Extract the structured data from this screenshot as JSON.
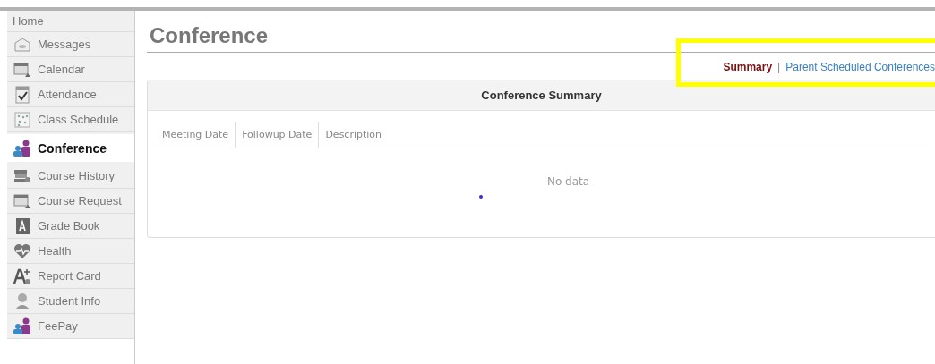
{
  "sidebar": {
    "home": "Home",
    "items": [
      {
        "label": "Messages",
        "selected": false
      },
      {
        "label": "Calendar",
        "selected": false
      },
      {
        "label": "Attendance",
        "selected": false
      },
      {
        "label": "Class Schedule",
        "selected": false
      },
      {
        "label": "Conference",
        "selected": true
      },
      {
        "label": "Course History",
        "selected": false
      },
      {
        "label": "Course Request",
        "selected": false
      },
      {
        "label": "Grade Book",
        "selected": false
      },
      {
        "label": "Health",
        "selected": false
      },
      {
        "label": "Report Card",
        "selected": false
      },
      {
        "label": "Student Info",
        "selected": false
      },
      {
        "label": "FeePay",
        "selected": false
      }
    ]
  },
  "page": {
    "title": "Conference",
    "links": [
      {
        "label": "Summary",
        "selected": true
      },
      {
        "label": "Parent Scheduled Conferences",
        "selected": false
      }
    ],
    "separator": "|",
    "highlight": {
      "color": "#ffff00"
    },
    "panel": {
      "title": "Conference Summary",
      "columns": [
        "Meeting Date",
        "Followup Date",
        "Description"
      ],
      "empty": "No data"
    }
  }
}
